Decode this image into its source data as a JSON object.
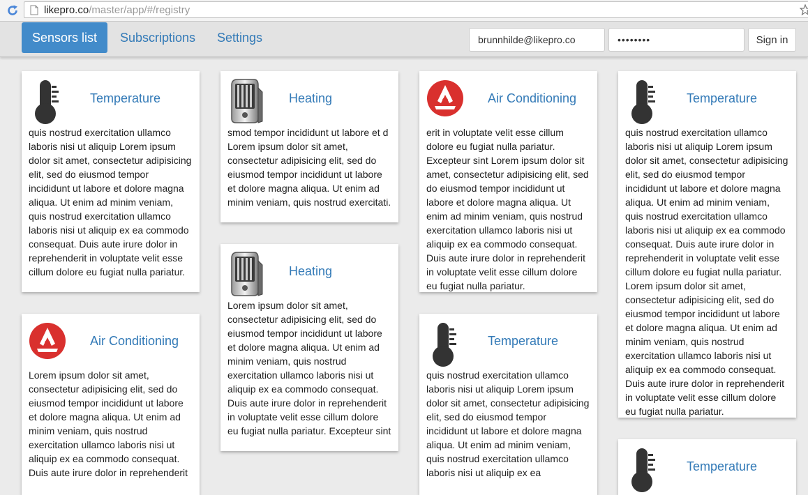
{
  "browser": {
    "url_host": "likepro.co",
    "url_path": "/master/app/#/registry"
  },
  "nav": {
    "items": [
      {
        "label": "Sensors list",
        "active": true
      },
      {
        "label": "Subscriptions",
        "active": false
      },
      {
        "label": "Settings",
        "active": false
      }
    ],
    "email_value": "brunnhilde@likepro.co",
    "password_value": "••••••••",
    "signin_label": "Sign in"
  },
  "cards": [
    {
      "icon": "thermometer-icon",
      "title": "Temperature",
      "text": "quis nostrud exercitation ullamco laboris nisi ut aliquip Lorem ipsum dolor sit amet, consectetur adipisicing elit, sed do eiusmod tempor incididunt ut labore et dolore magna aliqua. Ut enim ad minim veniam, quis nostrud exercitation ullamco laboris nisi ut aliquip ex ea commodo consequat. Duis aute irure dolor in reprehenderit in voluptate velit esse cillum dolore eu fugiat nulla pariatur."
    },
    {
      "icon": "air-conditioning-icon",
      "title": "Air Conditioning",
      "text": "Lorem ipsum dolor sit amet, consectetur adipisicing elit, sed do eiusmod tempor incididunt ut labore et dolore magna aliqua. Ut enim ad minim veniam, quis nostrud exercitation ullamco laboris nisi ut aliquip ex ea commodo consequat. Duis aute irure dolor in reprehenderit"
    },
    {
      "icon": "heater-icon",
      "title": "Heating",
      "text": "smod tempor incididunt ut labore et d Lorem ipsum dolor sit amet, consectetur adipisicing elit, sed do eiusmod tempor incididunt ut labore et dolore magna aliqua. Ut enim ad minim veniam, quis nostrud exercitati."
    },
    {
      "icon": "heater-icon",
      "title": "Heating",
      "text": "Lorem ipsum dolor sit amet, consectetur adipisicing elit, sed do eiusmod tempor incididunt ut labore et dolore magna aliqua. Ut enim ad minim veniam, quis nostrud exercitation ullamco laboris nisi ut aliquip ex ea commodo consequat. Duis aute irure dolor in reprehenderit in voluptate velit esse cillum dolore eu fugiat nulla pariatur. Excepteur sint"
    },
    {
      "icon": "air-conditioning-icon",
      "title": "Air Conditioning",
      "text": "erit in voluptate velit esse cillum dolore eu fugiat nulla pariatur. Excepteur sint Lorem ipsum dolor sit amet, consectetur adipisicing elit, sed do eiusmod tempor incididunt ut labore et dolore magna aliqua. Ut enim ad minim veniam, quis nostrud exercitation ullamco laboris nisi ut aliquip ex ea commodo consequat. Duis aute irure dolor in reprehenderit in voluptate velit esse cillum dolore eu fugiat nulla pariatur."
    },
    {
      "icon": "thermometer-icon",
      "title": "Temperature",
      "text": "quis nostrud exercitation ullamco laboris nisi ut aliquip Lorem ipsum dolor sit amet, consectetur adipisicing elit, sed do eiusmod tempor incididunt ut labore et dolore magna aliqua. Ut enim ad minim veniam, quis nostrud exercitation ullamco laboris nisi ut aliquip ex ea"
    },
    {
      "icon": "thermometer-icon",
      "title": "Temperature",
      "text": "quis nostrud exercitation ullamco laboris nisi ut aliquip Lorem ipsum dolor sit amet, consectetur adipisicing elit, sed do eiusmod tempor incididunt ut labore et dolore magna aliqua. Ut enim ad minim veniam, quis nostrud exercitation ullamco laboris nisi ut aliquip ex ea commodo consequat. Duis aute irure dolor in reprehenderit in voluptate velit esse cillum dolore eu fugiat nulla pariatur. Lorem ipsum dolor sit amet, consectetur adipisicing elit, sed do eiusmod tempor incididunt ut labore et dolore magna aliqua. Ut enim ad minim veniam, quis nostrud exercitation ullamco laboris nisi ut aliquip ex ea commodo consequat. Duis aute irure dolor in reprehenderit in voluptate velit esse cillum dolore eu fugiat nulla pariatur."
    },
    {
      "icon": "thermometer-icon",
      "title": "Temperature",
      "text": ""
    }
  ],
  "colors": {
    "accent": "#428bca",
    "link": "#337ab7",
    "ac_red": "#d9302e"
  }
}
